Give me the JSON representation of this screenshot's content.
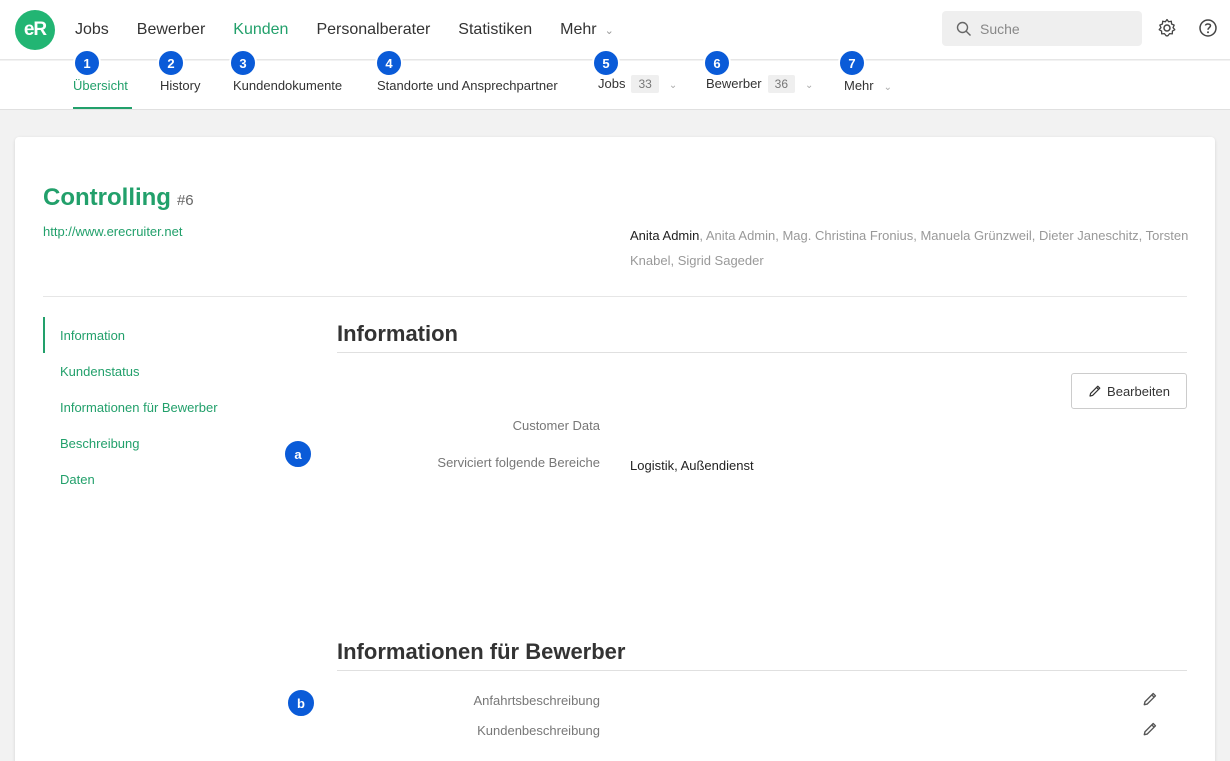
{
  "topnav": {
    "logo_text": "eR",
    "items": [
      "Jobs",
      "Bewerber",
      "Kunden",
      "Personalberater",
      "Statistiken"
    ],
    "more_label": "Mehr",
    "search_placeholder": "Suche"
  },
  "subnav": {
    "tabs": [
      {
        "num": "1",
        "label": "Übersicht"
      },
      {
        "num": "2",
        "label": "History"
      },
      {
        "num": "3",
        "label": "Kundendokumente"
      },
      {
        "num": "4",
        "label": "Standorte und Ansprechpartner"
      },
      {
        "num": "5",
        "label": "Jobs",
        "count": "33"
      },
      {
        "num": "6",
        "label": "Bewerber",
        "count": "36"
      },
      {
        "num": "7",
        "label": "Mehr"
      }
    ]
  },
  "customer": {
    "name": "Controlling",
    "id": "#6",
    "url": "http://www.erecruiter.net",
    "primary_contact": "Anita Admin",
    "other_contacts": ", Anita Admin, Mag. Christina Fronius, Manuela Grünzweil, Dieter Janeschitz, Torsten Knabel, Sigrid Sageder"
  },
  "sidenav": [
    "Information",
    "Kundenstatus",
    "Informationen für Bewerber",
    "Beschreibung",
    "Daten"
  ],
  "info_section": {
    "title": "Information",
    "edit_label": "Bearbeiten",
    "fields": [
      {
        "label": "Customer Data",
        "value": ""
      },
      {
        "label": "Serviciert folgende Bereiche",
        "value": "Logistik, Außendienst"
      }
    ],
    "marker": "a"
  },
  "applicant_section": {
    "title": "Informationen für Bewerber",
    "fields": [
      "Anfahrtsbeschreibung",
      "Kundenbeschreibung"
    ],
    "marker": "b"
  },
  "colors": {
    "accent": "#22a06b",
    "marker": "#0a5bd8"
  }
}
